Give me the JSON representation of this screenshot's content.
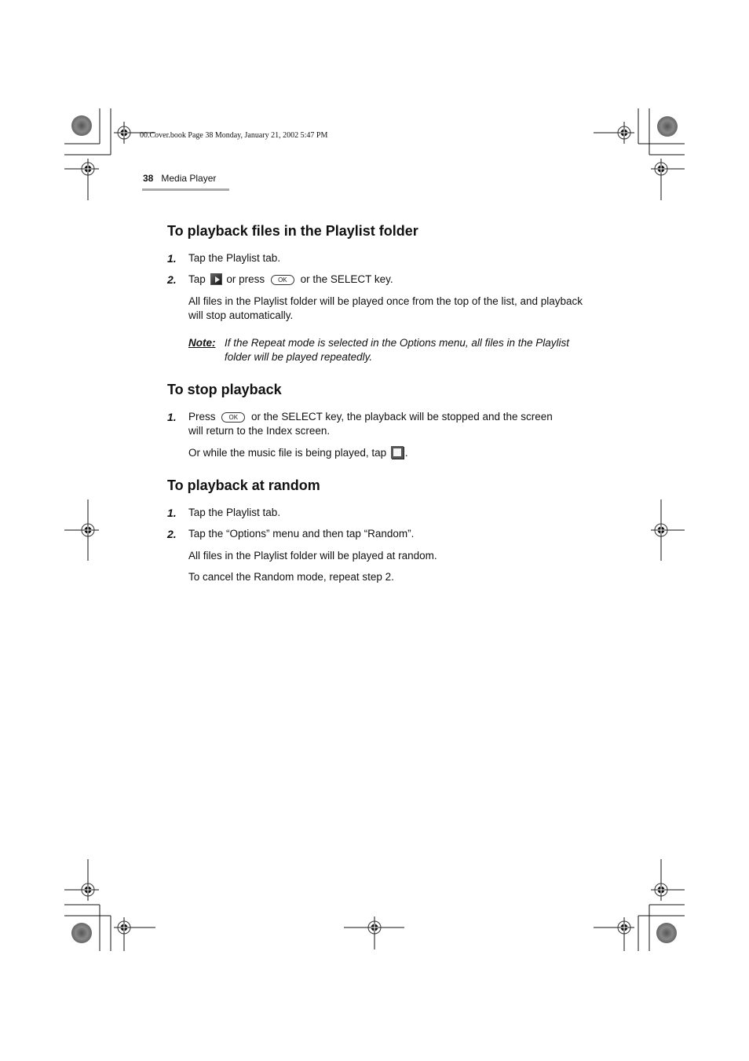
{
  "slug": "00.Cover.book  Page 38  Monday, January 21, 2002  5:47 PM",
  "running_head": {
    "page_number": "38",
    "section": "Media Player"
  },
  "sections": [
    {
      "title": "To playback files in the Playlist folder",
      "steps": [
        {
          "num": "1.",
          "text": "Tap the Playlist tab."
        },
        {
          "num": "2.",
          "pre": "Tap",
          "mid": "or press",
          "key": "OK",
          "post": "or the SELECT key."
        }
      ],
      "paragraph": "All files in the Playlist folder will be played once from the top of the list, and playback will stop automatically.",
      "note": {
        "label": "Note:",
        "text": "If the Repeat mode is selected in the Options menu, all files in the Playlist folder will be played repeatedly."
      }
    },
    {
      "title": "To stop playback",
      "steps": [
        {
          "num": "1.",
          "pre": "Press",
          "key": "OK",
          "post": "or the SELECT key, the playback will be stopped and the screen",
          "line2": "will return to the Index screen."
        }
      ],
      "paragraph_pre": "Or while the music file is being played, tap",
      "paragraph_post": "."
    },
    {
      "title": "To playback at random",
      "steps": [
        {
          "num": "1.",
          "text": "Tap the Playlist tab."
        },
        {
          "num": "2.",
          "text": "Tap the “Options” menu and then tap “Random”."
        }
      ],
      "paragraphs": [
        "All files in the Playlist folder will be played at random.",
        "To cancel the Random mode, repeat step 2."
      ]
    }
  ],
  "icons": {
    "play": "play-button-icon",
    "stop": "stop-button-icon",
    "ok_key": "ok-key-icon",
    "registration_mark": "registration-mark-icon",
    "color_target": "color-bar-target-icon"
  }
}
